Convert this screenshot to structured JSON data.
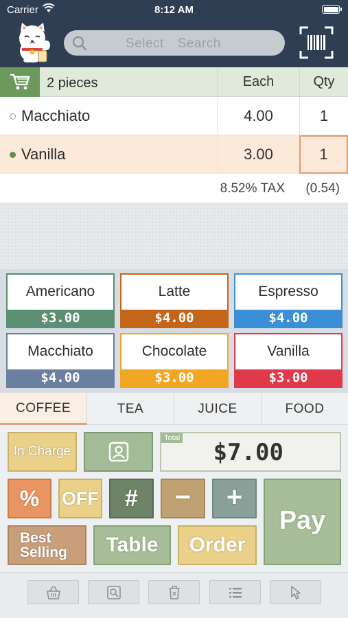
{
  "status_bar": {
    "carrier": "Carrier",
    "time": "8:12 AM"
  },
  "header": {
    "search_placeholder": "Select   Search"
  },
  "cart": {
    "pieces": "2 pieces",
    "col_each": "Each",
    "col_qty": "Qty",
    "items": [
      {
        "name": "Macchiato",
        "each": "4.00",
        "qty": "1",
        "selected": false
      },
      {
        "name": "Vanilla",
        "each": "3.00",
        "qty": "1",
        "selected": true
      }
    ],
    "tax_label": "8.52% TAX",
    "tax_value": "(0.54)"
  },
  "products": [
    {
      "name": "Americano",
      "price": "$3.00",
      "color": "#5b8f72"
    },
    {
      "name": "Latte",
      "price": "$4.00",
      "color": "#c4661a"
    },
    {
      "name": "Espresso",
      "price": "$4.00",
      "color": "#3a8fd6"
    },
    {
      "name": "Macchiato",
      "price": "$4.00",
      "color": "#6b7fa0"
    },
    {
      "name": "Chocolate",
      "price": "$3.00",
      "color": "#f2a724"
    },
    {
      "name": "Vanilla",
      "price": "$3.00",
      "color": "#e0394a"
    }
  ],
  "tabs": [
    {
      "label": "COFFEE",
      "active": true
    },
    {
      "label": "TEA",
      "active": false
    },
    {
      "label": "JUICE",
      "active": false
    },
    {
      "label": "FOOD",
      "active": false
    }
  ],
  "keypad": {
    "in_charge": "In Charge",
    "total_label": "Total",
    "total_value": "$7.00",
    "percent": "%",
    "off": "OFF",
    "hash": "#",
    "minus": "−",
    "plus": "+",
    "pay": "Pay",
    "best_line1": "Best",
    "best_line2": "Selling",
    "table": "Table",
    "order": "Order"
  },
  "toolbar_icons": [
    "basket-icon",
    "zoom-icon",
    "trash-icon",
    "list-icon",
    "cursor-icon"
  ]
}
